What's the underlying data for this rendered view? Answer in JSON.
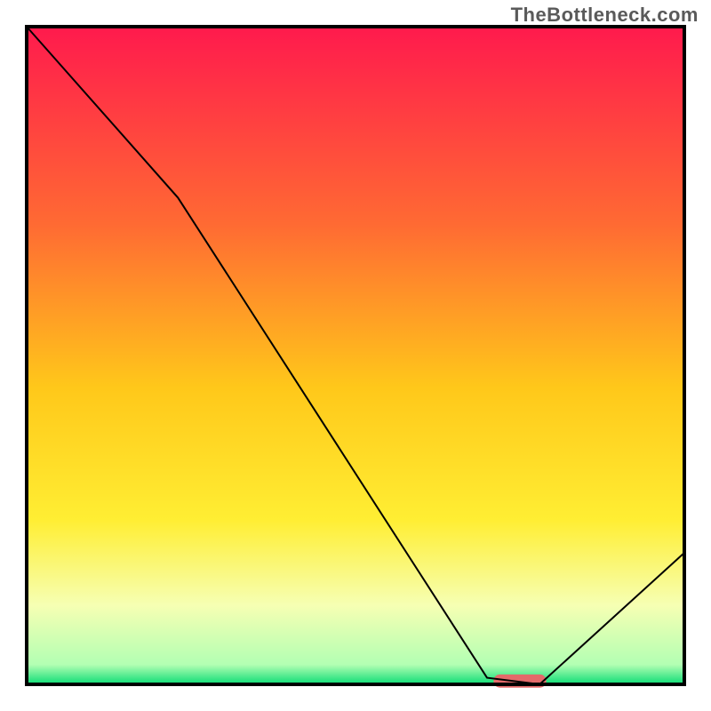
{
  "watermark": {
    "text": "TheBottleneck.com"
  },
  "chart_data": {
    "type": "line",
    "title": "",
    "xlabel": "",
    "ylabel": "",
    "xlim": [
      0,
      100
    ],
    "ylim": [
      0,
      100
    ],
    "legend_visible": false,
    "grid": false,
    "gradient_background": {
      "direction": "vertical_top_to_bottom",
      "stops": [
        {
          "pos": 0.0,
          "color": "#ff1a4d"
        },
        {
          "pos": 0.3,
          "color": "#ff6a33"
        },
        {
          "pos": 0.55,
          "color": "#ffc81a"
        },
        {
          "pos": 0.75,
          "color": "#ffee33"
        },
        {
          "pos": 0.88,
          "color": "#f6ffb3"
        },
        {
          "pos": 0.97,
          "color": "#b3ffb3"
        },
        {
          "pos": 1.0,
          "color": "#0bdc75"
        }
      ]
    },
    "series": [
      {
        "name": "bottleneck-curve",
        "color": "#000000",
        "stroke_width": 2,
        "x": [
          0,
          23,
          70,
          78,
          100
        ],
        "values": [
          100,
          74,
          1,
          0,
          20
        ]
      }
    ],
    "marker": {
      "name": "sweet-spot",
      "shape": "rounded-rect",
      "color": "#e46a6a",
      "x_center": 75,
      "y_center": 0.5,
      "width_x": 8,
      "height_y": 2
    },
    "border": {
      "color": "#000000",
      "stroke_width": 4
    }
  }
}
